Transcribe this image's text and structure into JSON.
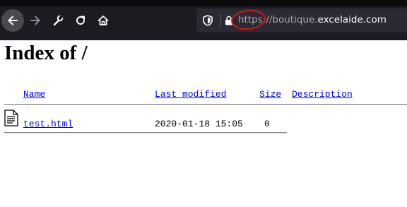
{
  "browser": {
    "url": {
      "scheme": "https://",
      "subdomain": "boutique.",
      "domain": "excelaide.com"
    },
    "icons": [
      "back-arrow-icon",
      "forward-arrow-icon",
      "wrench-icon",
      "reload-icon",
      "home-icon",
      "shield-icon",
      "lock-icon"
    ]
  },
  "page": {
    "title": "Index of /",
    "columns": {
      "name": "Name",
      "last_modified": "Last modified",
      "size": "Size",
      "description": "Description"
    },
    "rows": [
      {
        "name": "test.html",
        "last_modified": "2020-01-18 15:05",
        "size": "0",
        "description": ""
      }
    ]
  },
  "colors": {
    "annotation": "#d01818",
    "link": "#0000ee",
    "toolbar": "#1c1b22"
  }
}
